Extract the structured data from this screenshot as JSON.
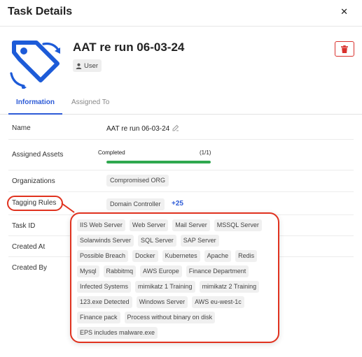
{
  "header": {
    "title": "Task Details"
  },
  "task": {
    "title": "AAT re run 06-03-24",
    "badge": "User"
  },
  "tabs": [
    {
      "label": "Information"
    },
    {
      "label": "Assigned To"
    }
  ],
  "fields": {
    "name": {
      "label": "Name",
      "value": "AAT re run 06-03-24"
    },
    "assigned_assets": {
      "label": "Assigned Assets",
      "status": "Completed",
      "count": "(1/1)",
      "progress_fraction": 1.0
    },
    "organizations": {
      "label": "Organizations",
      "chip": "Compromised ORG"
    },
    "tagging_rules": {
      "label": "Tagging Rules",
      "chip": "Domain Controller",
      "more": "+25"
    },
    "task_id": {
      "label": "Task ID"
    },
    "created_at": {
      "label": "Created At"
    },
    "created_by": {
      "label": "Created By"
    }
  },
  "tagging_popover": {
    "tags": [
      "IIS Web Server",
      "Web Server",
      "Mail Server",
      "MSSQL Server",
      "Solarwinds Server",
      "SQL Server",
      "SAP Server",
      "Possible Breach",
      "Docker",
      "Kubernetes",
      "Apache",
      "Redis",
      "Mysql",
      "Rabbitmq",
      "AWS Europe",
      "Finance Department",
      "Infected Systems",
      "mimikatz 1 Training",
      "mimikatz 2 Training",
      "123.exe Detected",
      "Windows Server",
      "AWS eu-west-1c",
      "Finance pack",
      "Process without binary on disk",
      "EPS includes malware.exe"
    ]
  },
  "colors": {
    "accent": "#2d5bd7",
    "icon_blue": "#1d5bd8",
    "danger": "#d9302c",
    "highlight": "#e0321f",
    "progress": "#2fa84f"
  },
  "icons": {
    "close": "close-icon",
    "task": "tag-icon",
    "user": "user-icon",
    "delete": "trash-icon",
    "edit": "edit-icon"
  }
}
